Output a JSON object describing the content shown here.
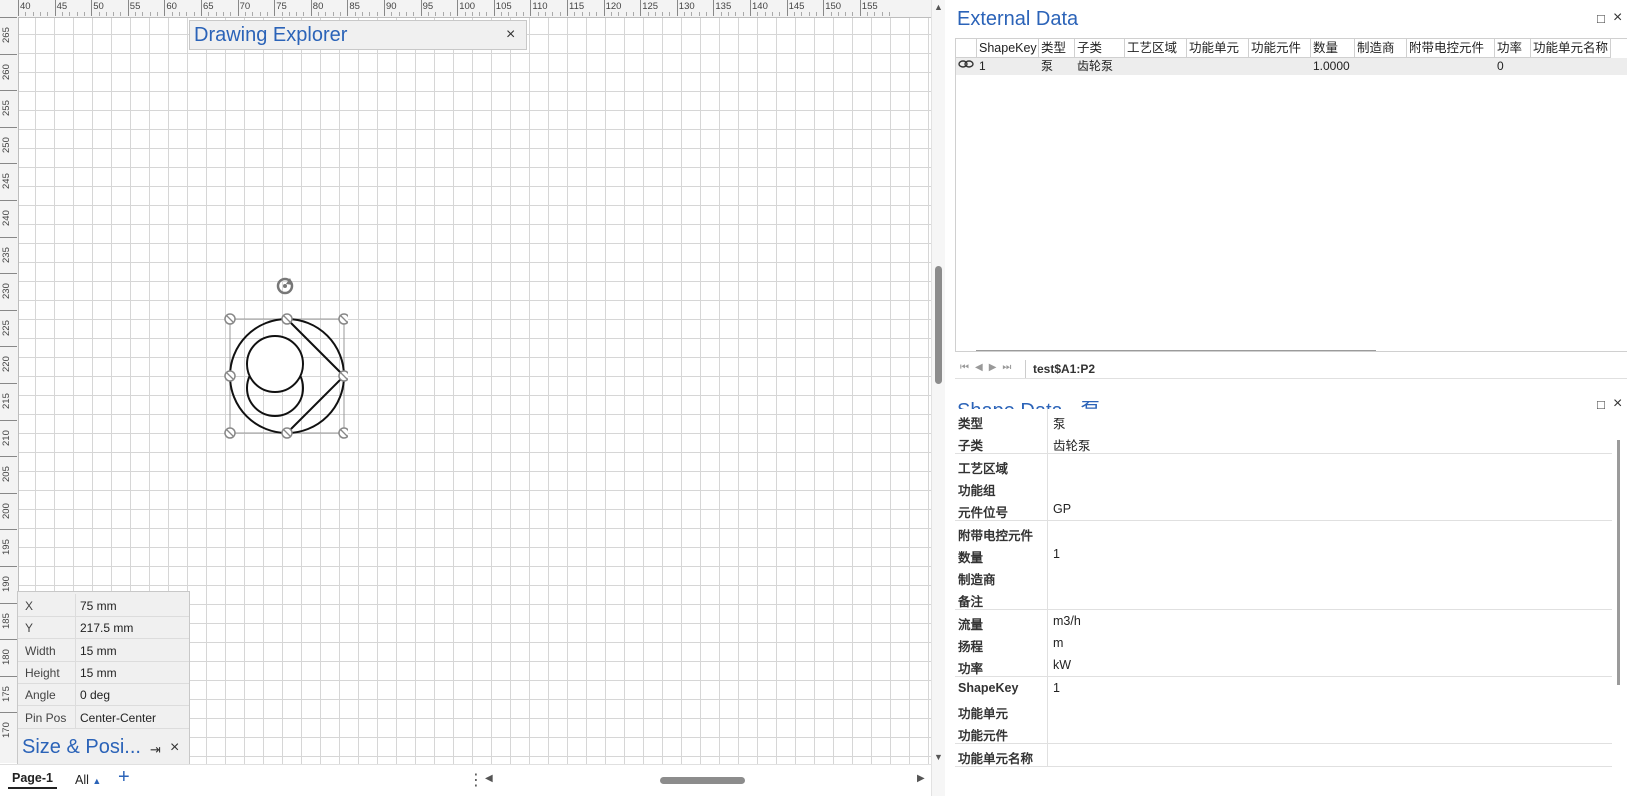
{
  "canvas": {
    "ruler_h_labels": [
      "40",
      "45",
      "50",
      "55",
      "60",
      "65",
      "70",
      "75",
      "80",
      "85",
      "90",
      "95",
      "100",
      "105",
      "110",
      "115",
      "120",
      "125",
      "130",
      "135",
      "140",
      "145",
      "150",
      "155"
    ],
    "ruler_v_labels": [
      "265",
      "260",
      "255",
      "250",
      "245",
      "240",
      "235",
      "230",
      "225",
      "220",
      "215",
      "210",
      "205",
      "200",
      "195",
      "190",
      "185",
      "180",
      "175",
      "170"
    ]
  },
  "drawing_explorer": {
    "title": "Drawing Explorer",
    "close": "×"
  },
  "size_position": {
    "title": "Size & Posi...",
    "rows": [
      {
        "label": "X",
        "value": "75 mm"
      },
      {
        "label": "Y",
        "value": "217.5 mm"
      },
      {
        "label": "Width",
        "value": "15 mm"
      },
      {
        "label": "Height",
        "value": "15 mm"
      },
      {
        "label": "Angle",
        "value": "0 deg"
      },
      {
        "label": "Pin Pos",
        "value": "Center-Center"
      }
    ],
    "pin": "⇥",
    "close": "×"
  },
  "page_tabs": {
    "active": "Page-1",
    "all": "All",
    "add": "+"
  },
  "external_data": {
    "title": "External Data",
    "columns": [
      "ShapeKey",
      "类型",
      "子类",
      "工艺区域",
      "功能单元",
      "功能元件",
      "数量",
      "制造商",
      "附带电控元件",
      "功率",
      "功能单元名称"
    ],
    "rows": [
      [
        "1",
        "泵",
        "齿轮泵",
        "",
        "",
        "",
        "1.0000",
        "",
        "",
        "0",
        ""
      ]
    ],
    "sheet_tab": "test$A1:P2"
  },
  "shape_data": {
    "title": "Shape Data - 泵",
    "rows": [
      {
        "label": "类型",
        "value": "泵"
      },
      {
        "label": "子类",
        "value": "齿轮泵"
      },
      {
        "label": "工艺区域",
        "value": ""
      },
      {
        "label": "功能组",
        "value": ""
      },
      {
        "label": "元件位号",
        "value": "GP"
      },
      {
        "label": "附带电控元件",
        "value": ""
      },
      {
        "label": "数量",
        "value": "1"
      },
      {
        "label": "制造商",
        "value": ""
      },
      {
        "label": "备注",
        "value": ""
      },
      {
        "label": "流量",
        "value": "m3/h"
      },
      {
        "label": "扬程",
        "value": "m"
      },
      {
        "label": "功率",
        "value": "kW"
      },
      {
        "label": "ShapeKey",
        "value": "1"
      },
      {
        "label": "功能单元",
        "value": ""
      },
      {
        "label": "功能元件",
        "value": ""
      },
      {
        "label": "功能单元名称",
        "value": ""
      }
    ]
  },
  "icons": {
    "maximize": "□",
    "close": "×"
  }
}
